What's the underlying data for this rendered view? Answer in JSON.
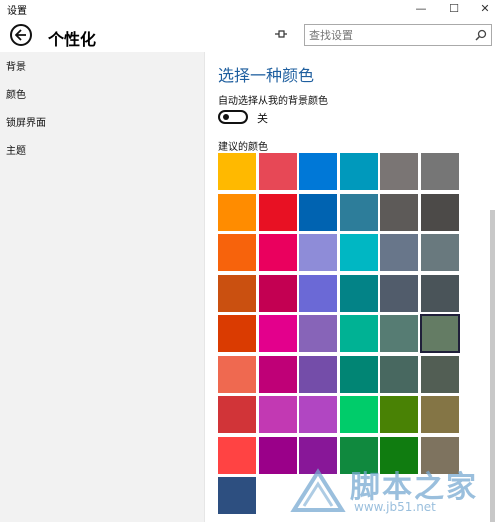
{
  "window": {
    "title": "设置",
    "minimize": "—",
    "maximize": "☐",
    "close": "✕"
  },
  "header": {
    "back_icon": "back-arrow-icon",
    "title": "个性化",
    "pin_icon": "pin-icon",
    "search_placeholder": "查找设置",
    "search_icon": "search-icon"
  },
  "nav": {
    "items": [
      {
        "label": "背景"
      },
      {
        "label": "颜色"
      },
      {
        "label": "锁屏界面"
      },
      {
        "label": "主题"
      }
    ]
  },
  "main": {
    "section_title": "选择一种颜色",
    "auto_label": "自动选择从我的背景颜色",
    "toggle_state": "关",
    "toggle_on": false,
    "suggest_label": "建议的颜色",
    "selected_index": 29,
    "swatches": [
      "#ffb900",
      "#e74856",
      "#0078d7",
      "#0099bc",
      "#7a7574",
      "#767676",
      "#ff8c00",
      "#e81123",
      "#0063b1",
      "#2d7d9a",
      "#5d5a58",
      "#4c4a48",
      "#f7630c",
      "#ea005e",
      "#8e8cd8",
      "#00b7c3",
      "#68768a",
      "#69797e",
      "#ca5010",
      "#c30052",
      "#6b69d6",
      "#038387",
      "#515c6b",
      "#4a5459",
      "#da3b01",
      "#e3008c",
      "#8764b8",
      "#00b294",
      "#567c73",
      "#647c64",
      "#ef6950",
      "#bf0077",
      "#744da9",
      "#018574",
      "#486860",
      "#525e54",
      "#d13438",
      "#c239b3",
      "#b146c2",
      "#00cc6a",
      "#498205",
      "#847545",
      "#ff4343",
      "#9a0089",
      "#881798",
      "#10893e",
      "#107c10",
      "#7e735f",
      "#2d4f80"
    ]
  },
  "watermark": {
    "text": "脚本之家",
    "url": "www.jb51.net"
  }
}
